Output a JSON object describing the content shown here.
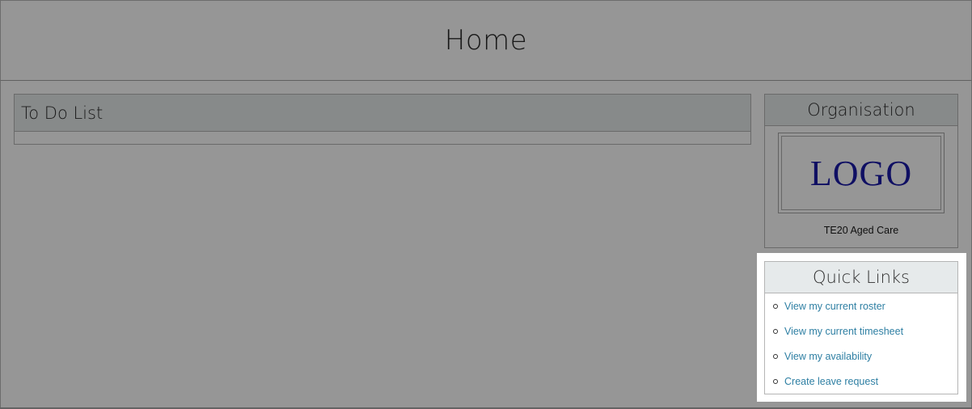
{
  "header": {
    "title": "Home"
  },
  "todo": {
    "title": "To Do List",
    "items": []
  },
  "organisation": {
    "title": "Organisation",
    "logo_text": "LOGO",
    "name": "TE20 Aged Care"
  },
  "quick_links": {
    "title": "Quick Links",
    "links": [
      {
        "label": "View my current roster"
      },
      {
        "label": "View my current timesheet"
      },
      {
        "label": "View my availability"
      },
      {
        "label": "Create leave request"
      }
    ]
  },
  "colors": {
    "overlay": "#000000",
    "link": "#2e7fa3",
    "panel_header": "#e6eaeb",
    "logo": "#1a1aa8"
  }
}
